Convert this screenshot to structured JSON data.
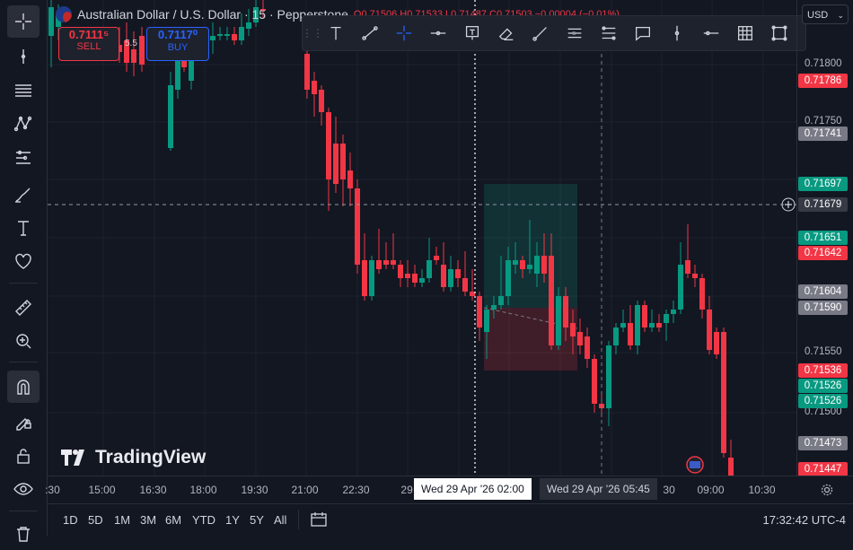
{
  "header": {
    "symbol_title": "Australian Dollar / U.S. Dollar · 15 · Pepperstone",
    "ohlc": "O0.71506  H0.71533  L0.71487  C0.71503  −0.00004 (−0.01%)",
    "sell_price": "0.7111⁵",
    "sell_label": "SELL",
    "spread": "5.5",
    "buy_price": "0.7117⁰",
    "buy_label": "BUY",
    "currency": "USD"
  },
  "price_axis": {
    "ticks": [
      "0.71800",
      "0.71750",
      "0.71550",
      "0.71500"
    ],
    "labels": [
      {
        "text": "0.71786",
        "color": "#f23645"
      },
      {
        "text": "0.71741",
        "color": "#787b86"
      },
      {
        "text": "0.71697",
        "color": "#089981"
      },
      {
        "text": "0.71679",
        "color": "#363a45"
      },
      {
        "text": "0.71651",
        "color": "#089981"
      },
      {
        "text": "0.71642",
        "color": "#f23645"
      },
      {
        "text": "0.71604",
        "color": "#787b86"
      },
      {
        "text": "0.71590",
        "color": "#787b86"
      },
      {
        "text": "0.71536",
        "color": "#f23645"
      },
      {
        "text": "0.71526",
        "color": "#089981"
      },
      {
        "text": "0.71526",
        "color": "#089981"
      },
      {
        "text": "0.71473",
        "color": "#787b86"
      },
      {
        "text": "0.71447",
        "color": "#f23645"
      }
    ]
  },
  "time_axis": {
    "labels": [
      ":30",
      "15:00",
      "16:30",
      "18:00",
      "19:30",
      "21:00",
      "22:30",
      "29",
      "30",
      "09:00",
      "10:30"
    ],
    "crosshair_label": "Wed 29 Apr '26   02:00",
    "marker_label": "Wed 29 Apr '26   05:45"
  },
  "timeframes": [
    "1D",
    "5D",
    "1M",
    "3M",
    "6M",
    "YTD",
    "1Y",
    "5Y",
    "All"
  ],
  "clock": "17:32:42 UTC-4",
  "watermark": "TradingView",
  "colors": {
    "up": "#089981",
    "down": "#f23645",
    "bg": "#131722"
  }
}
